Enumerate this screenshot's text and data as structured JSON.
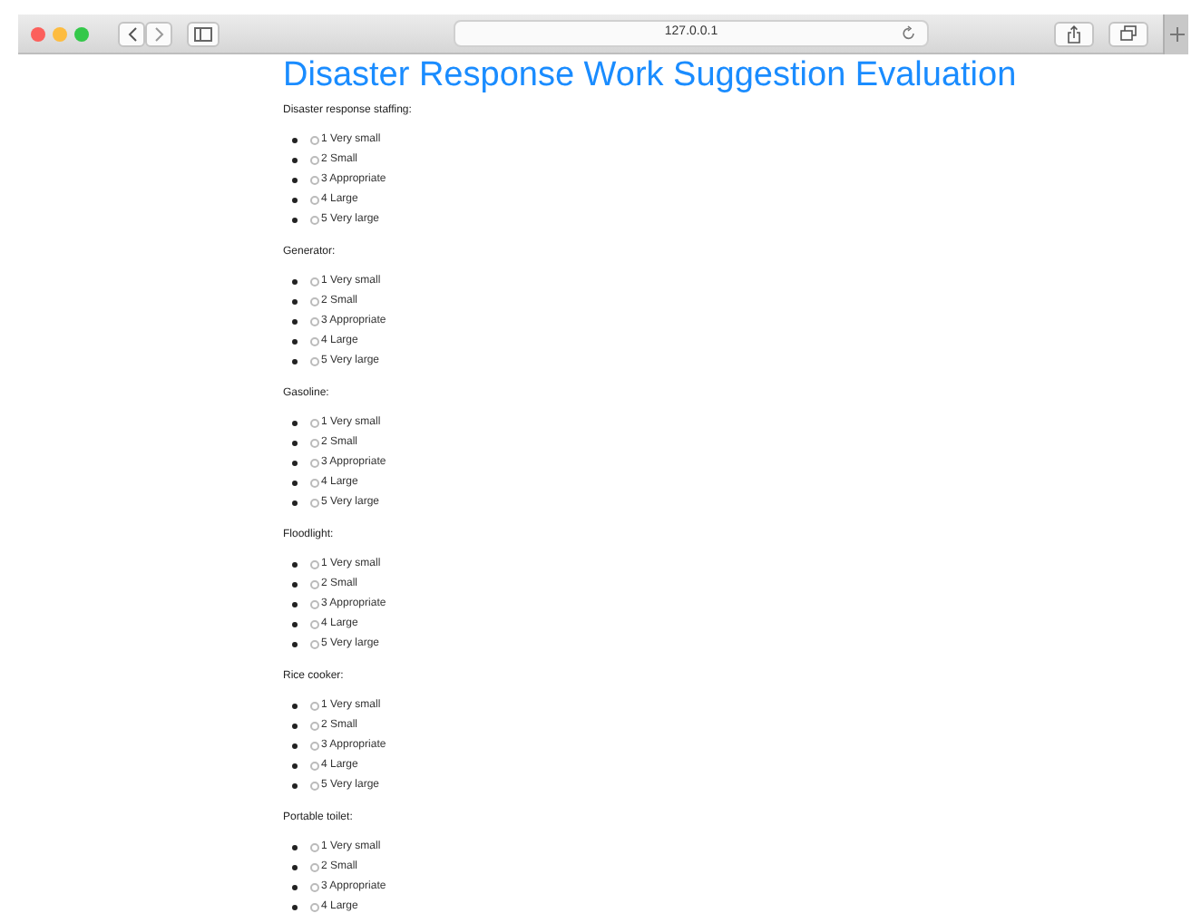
{
  "browser": {
    "address": "127.0.0.1"
  },
  "page": {
    "title": "Disaster Response Work Suggestion Evaluation",
    "questions": [
      {
        "label": "Disaster response staffing:",
        "options": [
          {
            "label": "1 Very small",
            "selected": false
          },
          {
            "label": "2 Small",
            "selected": false
          },
          {
            "label": "3 Appropriate",
            "selected": false
          },
          {
            "label": "4 Large",
            "selected": false
          },
          {
            "label": "5 Very large",
            "selected": false
          }
        ]
      },
      {
        "label": "Generator:",
        "options": [
          {
            "label": "1 Very small",
            "selected": false
          },
          {
            "label": "2 Small",
            "selected": false
          },
          {
            "label": "3 Appropriate",
            "selected": false
          },
          {
            "label": "4 Large",
            "selected": false
          },
          {
            "label": "5 Very large",
            "selected": false
          }
        ]
      },
      {
        "label": "Gasoline:",
        "options": [
          {
            "label": "1 Very small",
            "selected": false
          },
          {
            "label": "2 Small",
            "selected": false
          },
          {
            "label": "3 Appropriate",
            "selected": false
          },
          {
            "label": "4 Large",
            "selected": false
          },
          {
            "label": "5 Very large",
            "selected": false
          }
        ]
      },
      {
        "label": "Floodlight:",
        "options": [
          {
            "label": "1 Very small",
            "selected": false
          },
          {
            "label": "2 Small",
            "selected": false
          },
          {
            "label": "3 Appropriate",
            "selected": false
          },
          {
            "label": "4 Large",
            "selected": false
          },
          {
            "label": "5 Very large",
            "selected": false
          }
        ]
      },
      {
        "label": "Rice cooker:",
        "options": [
          {
            "label": "1 Very small",
            "selected": false
          },
          {
            "label": "2 Small",
            "selected": false
          },
          {
            "label": "3 Appropriate",
            "selected": false
          },
          {
            "label": "4 Large",
            "selected": false
          },
          {
            "label": "5 Very large",
            "selected": false
          }
        ]
      },
      {
        "label": "Portable toilet:",
        "options": [
          {
            "label": "1 Very small",
            "selected": false
          },
          {
            "label": "2 Small",
            "selected": false
          },
          {
            "label": "3 Appropriate",
            "selected": false
          },
          {
            "label": "4 Large",
            "selected": false
          }
        ]
      }
    ]
  }
}
